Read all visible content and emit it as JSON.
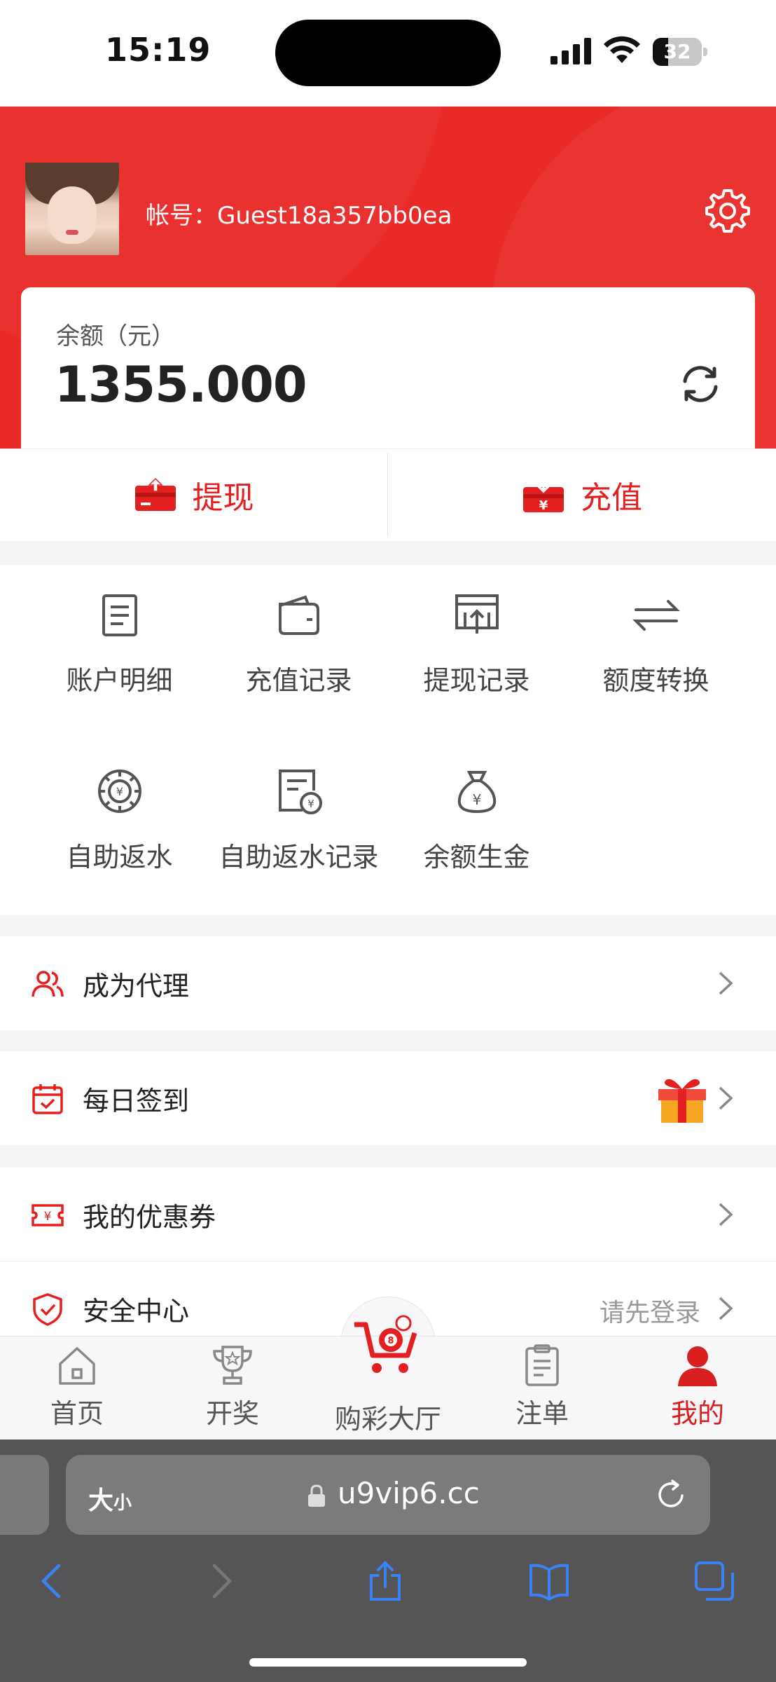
{
  "status_bar": {
    "time": "15:19",
    "battery": "32",
    "battery_level": 0.32
  },
  "header": {
    "account_label": "帐号：",
    "account_id": "Guest18a357bb0ea"
  },
  "balance": {
    "label": "余额（元）",
    "value": "1355.000"
  },
  "actions": [
    {
      "label": "提现",
      "icon": "withdraw-icon"
    },
    {
      "label": "充值",
      "icon": "recharge-icon"
    }
  ],
  "menu_grid": [
    {
      "label": "账户明细",
      "icon": "document-icon"
    },
    {
      "label": "充值记录",
      "icon": "wallet-icon"
    },
    {
      "label": "提现记录",
      "icon": "withdraw-record-icon"
    },
    {
      "label": "额度转换",
      "icon": "transfer-icon"
    },
    {
      "label": "自助返水",
      "icon": "rebate-chip-icon"
    },
    {
      "label": "自助返水记录",
      "icon": "rebate-record-icon"
    },
    {
      "label": "余额生金",
      "icon": "money-bag-icon"
    }
  ],
  "list": [
    {
      "label": "成为代理",
      "icon": "users-icon",
      "right_text": ""
    },
    {
      "label": "每日签到",
      "icon": "calendar-check-icon",
      "right_text": ""
    },
    {
      "label": "我的优惠券",
      "icon": "coupon-icon",
      "right_text": ""
    },
    {
      "label": "安全中心",
      "icon": "shield-check-icon",
      "right_text": "请先登录"
    }
  ],
  "tabs": [
    {
      "label": "首页",
      "icon": "home-icon",
      "active": false
    },
    {
      "label": "开奖",
      "icon": "trophy-icon",
      "active": false
    },
    {
      "label": "购彩大厅",
      "icon": "cart-icon",
      "active": false
    },
    {
      "label": "注单",
      "icon": "clipboard-icon",
      "active": false
    },
    {
      "label": "我的",
      "icon": "user-icon",
      "active": true
    }
  ],
  "browser": {
    "text_size_big": "大",
    "text_size_small": "小",
    "url": "u9vip6.cc"
  },
  "colors": {
    "brand_red": "#e92a27",
    "active_tab": "#d81e1e",
    "link_blue": "#2f7cf6"
  }
}
